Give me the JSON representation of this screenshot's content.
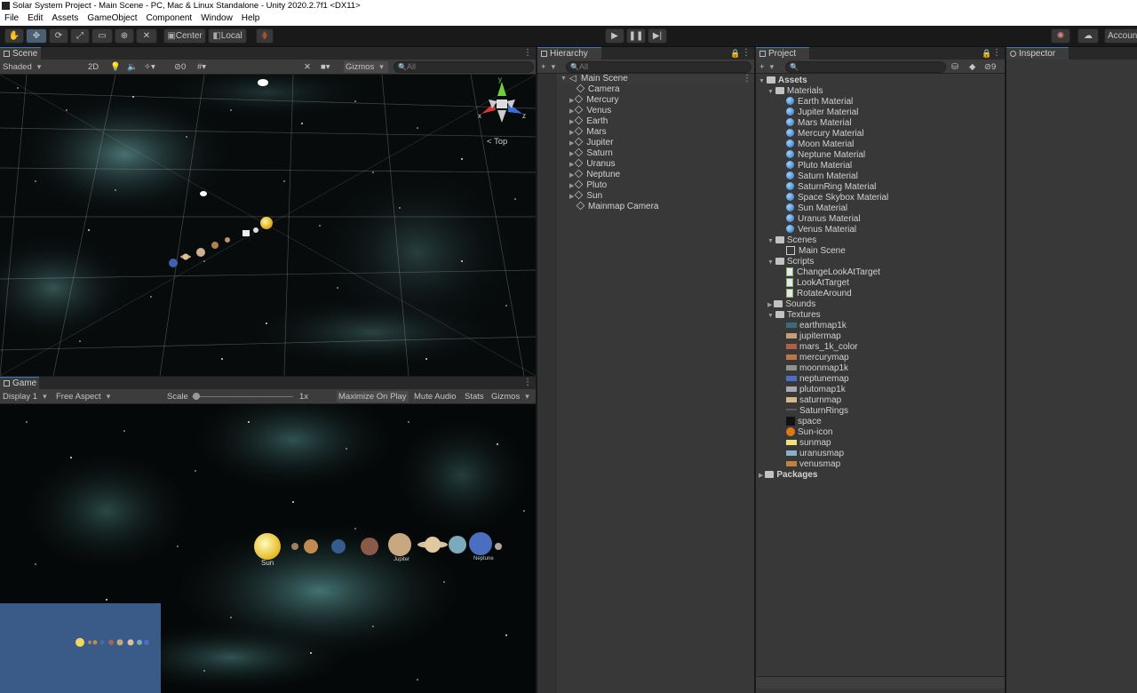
{
  "window": {
    "title": "Solar System Project - Main Scene - PC, Mac & Linux Standalone - Unity 2020.2.7f1 <DX11>"
  },
  "menu": [
    "File",
    "Edit",
    "Assets",
    "GameObject",
    "Component",
    "Window",
    "Help"
  ],
  "toolbar": {
    "pivot_label": "Center",
    "space_label": "Local",
    "account_label": "Account"
  },
  "scene": {
    "tab": "Scene",
    "shading": "Shaded",
    "mode_2d": "2D",
    "hidden_count": "0",
    "gizmos": "Gizmos",
    "search_placeholder": "All",
    "orientation": "Top",
    "axis_x": "x",
    "axis_y": "y",
    "axis_z": "z"
  },
  "game": {
    "tab": "Game",
    "display": "Display 1",
    "aspect": "Free Aspect",
    "scale_label": "Scale",
    "scale_value": "1x",
    "maximize": "Maximize On Play",
    "mute": "Mute Audio",
    "stats": "Stats",
    "gizmos": "Gizmos",
    "planets": [
      "Sun",
      "Mercury",
      "Venus",
      "Earth",
      "Mars",
      "Jupiter",
      "Saturn",
      "Uranus",
      "Neptune",
      "Pluto"
    ],
    "visible_planet_labels": [
      "Sun",
      "Jupiter",
      "Neptune"
    ]
  },
  "hierarchy": {
    "tab": "Hierarchy",
    "search_placeholder": "All",
    "root": "Main Scene",
    "items": [
      "Camera",
      "Mercury",
      "Venus",
      "Earth",
      "Mars",
      "Jupiter",
      "Saturn",
      "Uranus",
      "Neptune",
      "Pluto",
      "Sun",
      "Mainmap Camera"
    ]
  },
  "project": {
    "tab": "Project",
    "hidden_count": "9",
    "assets": "Assets",
    "materials_folder": "Materials",
    "materials": [
      "Earth Material",
      "Jupiter Material",
      "Mars Material",
      "Mercury Material",
      "Moon Material",
      "Neptune Material",
      "Pluto Material",
      "Saturn Material",
      "SaturnRing Material",
      "Space Skybox Material",
      "Sun Material",
      "Uranus Material",
      "Venus Material"
    ],
    "scenes_folder": "Scenes",
    "scenes": [
      "Main Scene"
    ],
    "scripts_folder": "Scripts",
    "scripts": [
      "ChangeLookAtTarget",
      "LookAtTarget",
      "RotateAround"
    ],
    "sounds_folder": "Sounds",
    "textures_folder": "Textures",
    "textures": [
      "earthmap1k",
      "jupitermap",
      "mars_1k_color",
      "mercurymap",
      "moonmap1k",
      "neptunemap",
      "plutomap1k",
      "saturnmap",
      "SaturnRings",
      "space",
      "Sun-icon",
      "sunmap",
      "uranusmap",
      "venusmap"
    ],
    "packages": "Packages"
  },
  "inspector": {
    "tab": "Inspector"
  },
  "colors": {
    "panel": "#383838",
    "tab_bg": "#282828",
    "accent": "#3a79bb",
    "minimap_bg": "#3a5a88"
  }
}
